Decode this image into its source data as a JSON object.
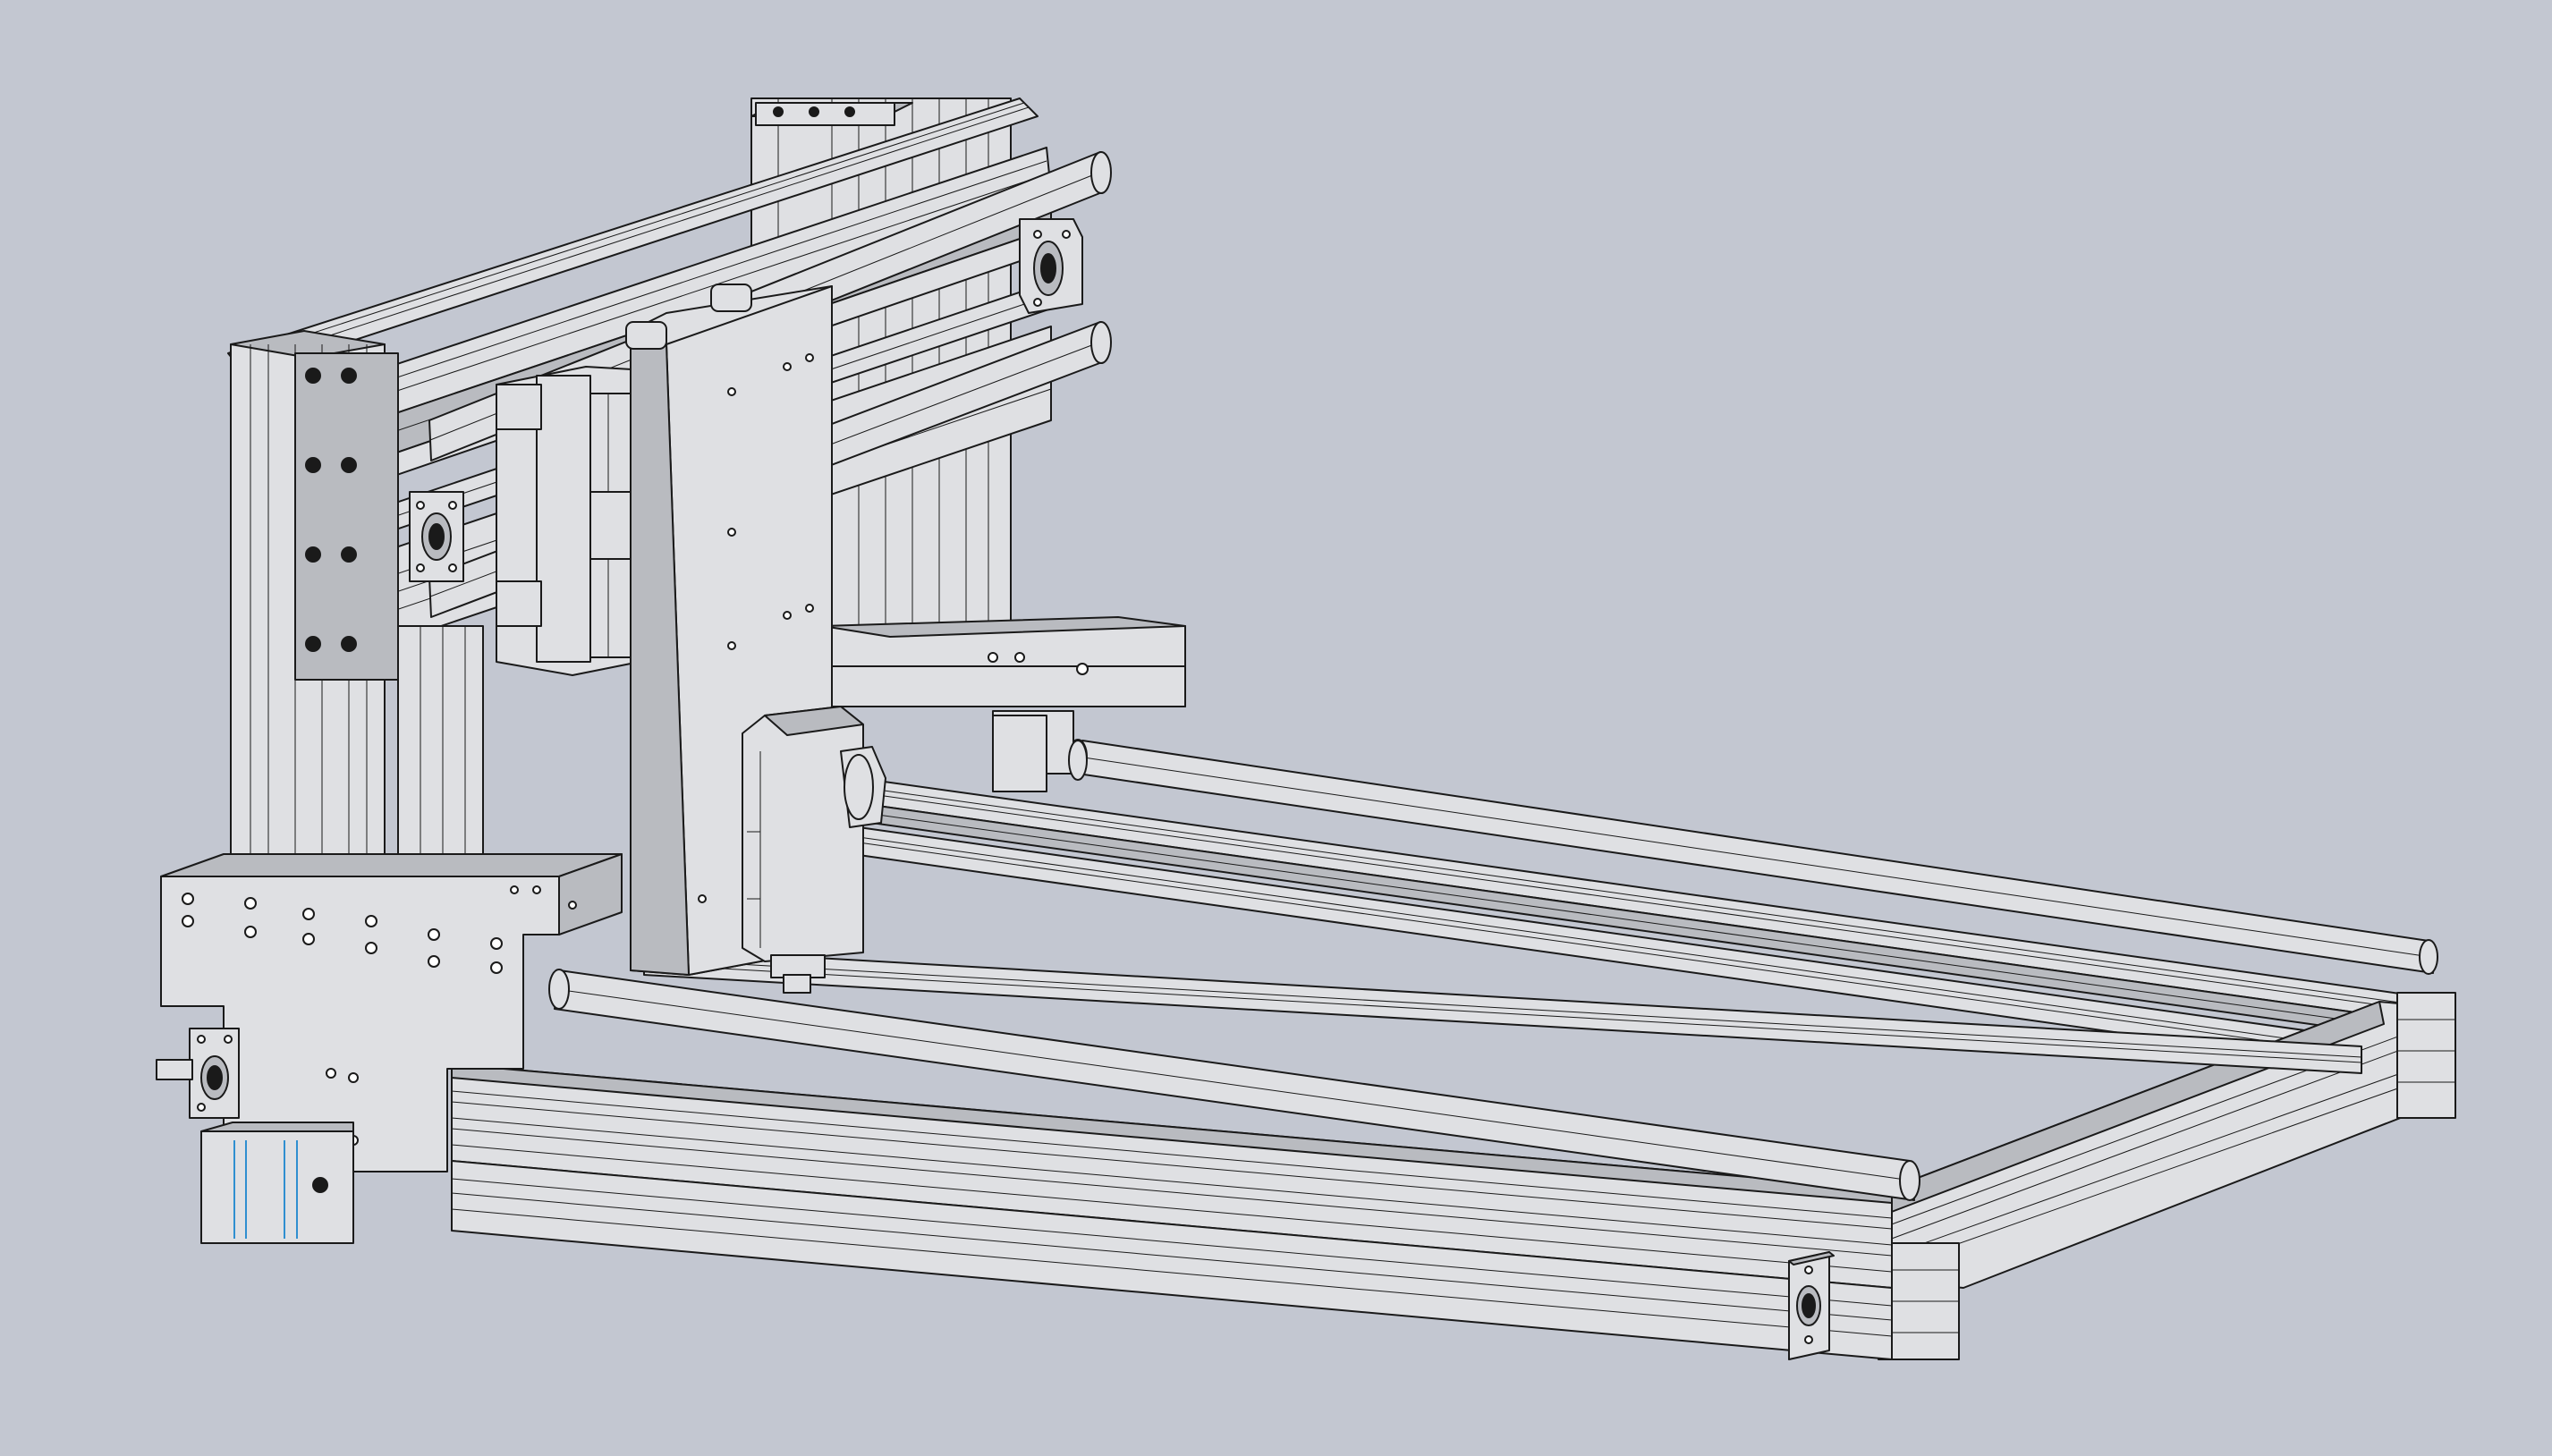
{
  "viewport": {
    "background": "#c3c7d1",
    "part_fill": "#dfe0e3",
    "part_fill_dark": "#b9bbc0",
    "edge_color": "#1a1a1a",
    "highlight_edge_color": "#2f8fd0"
  },
  "model": {
    "parts": [
      "base-rail-front",
      "base-rail-back",
      "base-end-rail-right",
      "linear-rod-front",
      "linear-rod-back",
      "gantry-column-left",
      "gantry-column-right",
      "gantry-beam",
      "gantry-rod-upper",
      "gantry-rod-lower",
      "x-carriage",
      "z-plate",
      "spindle",
      "side-bracket-plate",
      "stepper-motor",
      "bearing-block-front-right",
      "bearing-block-top-right",
      "bearing-block-gantry-left"
    ]
  }
}
